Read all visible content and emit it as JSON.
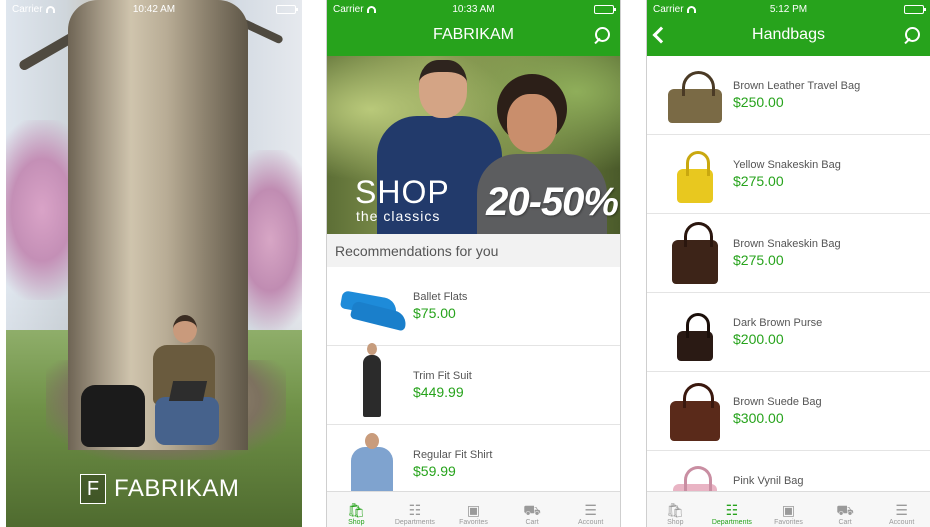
{
  "splash": {
    "status": {
      "carrier": "Carrier",
      "time": "10:42 AM"
    },
    "brand_letter": "F",
    "brand_name": "FABRIKAM"
  },
  "home": {
    "status": {
      "carrier": "Carrier",
      "time": "10:33 AM"
    },
    "title": "FABRIKAM",
    "banner": {
      "headline": "SHOP",
      "subline": "the classics",
      "discount": "20-50%"
    },
    "section_title": "Recommendations for you",
    "items": [
      {
        "name": "Ballet Flats",
        "price": "$75.00"
      },
      {
        "name": "Trim Fit Suit",
        "price": "$449.99"
      },
      {
        "name": "Regular Fit Shirt",
        "price": "$59.99"
      }
    ],
    "tabs": [
      {
        "label": "Shop",
        "icon": "shopping-bag-icon",
        "active": true
      },
      {
        "label": "Departments",
        "icon": "departments-icon",
        "active": false
      },
      {
        "label": "Favorites",
        "icon": "favorites-icon",
        "active": false
      },
      {
        "label": "Cart",
        "icon": "cart-icon",
        "active": false
      },
      {
        "label": "Account",
        "icon": "account-icon",
        "active": false
      }
    ]
  },
  "category": {
    "status": {
      "carrier": "Carrier",
      "time": "5:12 PM"
    },
    "title": "Handbags",
    "items": [
      {
        "name": "Brown Leather Travel Bag",
        "price": "$250.00",
        "color": "#7a6a45"
      },
      {
        "name": "Yellow Snakeskin Bag",
        "price": "$275.00",
        "color": "#e8c81f"
      },
      {
        "name": "Brown Snakeskin Bag",
        "price": "$275.00",
        "color": "#3d2418"
      },
      {
        "name": "Dark Brown Purse",
        "price": "$200.00",
        "color": "#2a1a14"
      },
      {
        "name": "Brown Suede Bag",
        "price": "$300.00",
        "color": "#5a2a1a"
      },
      {
        "name": "Pink Vynil Bag",
        "price": "",
        "color": "#e9b4c4"
      }
    ],
    "tabs": [
      {
        "label": "Shop",
        "icon": "shopping-bag-icon",
        "active": false
      },
      {
        "label": "Departments",
        "icon": "departments-icon",
        "active": true
      },
      {
        "label": "Favorites",
        "icon": "favorites-icon",
        "active": false
      },
      {
        "label": "Cart",
        "icon": "cart-icon",
        "active": false
      },
      {
        "label": "Account",
        "icon": "account-icon",
        "active": false
      }
    ]
  },
  "colors": {
    "accent": "#27a31c",
    "price": "#27a31c",
    "section_bg": "#f2f2f2"
  }
}
